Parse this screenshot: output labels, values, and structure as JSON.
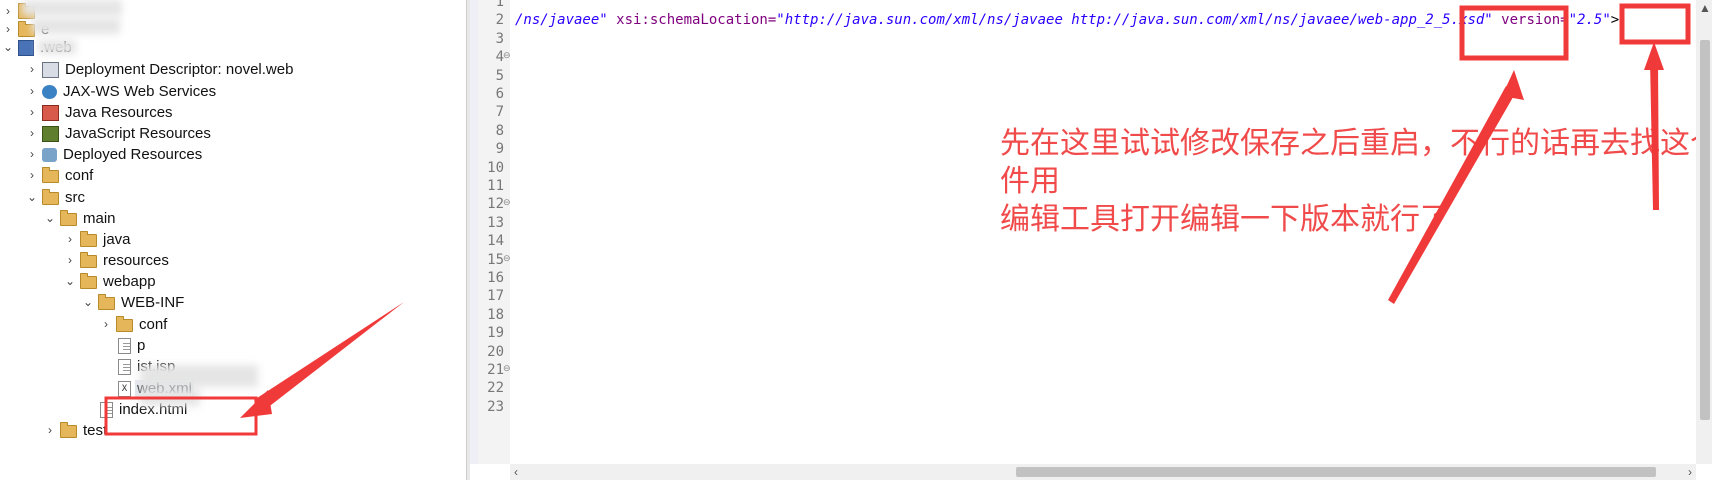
{
  "explorer": {
    "items": [
      {
        "label": "",
        "toggle": "›",
        "icon": "folder-icon"
      },
      {
        "label": "e",
        "toggle": "›",
        "icon": "folder-icon"
      },
      {
        "label": ".web",
        "toggle": "⌄",
        "icon": "web-project-icon"
      },
      {
        "label": "Deployment Descriptor: novel.web",
        "toggle": "›",
        "icon": "deployment-descriptor-icon"
      },
      {
        "label": "JAX-WS Web Services",
        "toggle": "›",
        "icon": "web-services-icon"
      },
      {
        "label": "Java Resources",
        "toggle": "›",
        "icon": "java-resources-icon"
      },
      {
        "label": "JavaScript Resources",
        "toggle": "›",
        "icon": "javascript-resources-icon"
      },
      {
        "label": "Deployed Resources",
        "toggle": "›",
        "icon": "deployed-resources-icon"
      },
      {
        "label": "conf",
        "toggle": "›",
        "icon": "folder-icon"
      },
      {
        "label": "src",
        "toggle": "⌄",
        "icon": "folder-icon"
      },
      {
        "label": "main",
        "toggle": "⌄",
        "icon": "folder-icon"
      },
      {
        "label": "java",
        "toggle": "›",
        "icon": "folder-icon"
      },
      {
        "label": "resources",
        "toggle": "›",
        "icon": "folder-icon"
      },
      {
        "label": "webapp",
        "toggle": "⌄",
        "icon": "folder-icon"
      },
      {
        "label": "WEB-INF",
        "toggle": "⌄",
        "icon": "folder-icon"
      },
      {
        "label": "conf",
        "toggle": "›",
        "icon": "folder-icon"
      },
      {
        "label": "p",
        "toggle": "",
        "icon": "file-icon"
      },
      {
        "label": "ist.jsp",
        "toggle": "",
        "icon": "file-icon"
      },
      {
        "label": "web.xml",
        "toggle": "",
        "icon": "xml-file-icon",
        "selected": true
      },
      {
        "label": "index.html",
        "toggle": "",
        "icon": "file-icon"
      },
      {
        "label": "test",
        "toggle": "›",
        "icon": "folder-icon"
      }
    ]
  },
  "editor": {
    "line_numbers": [
      "1",
      "2",
      "3",
      "4",
      "5",
      "6",
      "7",
      "8",
      "9",
      "10",
      "11",
      "12",
      "13",
      "14",
      "15",
      "16",
      "17",
      "18",
      "19",
      "20",
      "21",
      "22",
      "23"
    ],
    "code_line2": {
      "part1": "/ns/javaee\"",
      "part2": " xsi:schemaLocation=",
      "part3": "\"http://java.sun.com/xml/ns/javaee http://java.sun.com/xml/ns/javaee/web-app_2_5.xsd\"",
      "part4": " version=",
      "part5": "\"2.5\"",
      "part6": ">"
    },
    "annotation_line1": "先在这里试试修改保存之后重启，不行的话再去找这个原文件用",
    "annotation_line2": "编辑工具打开编辑一下版本就行了"
  },
  "colors": {
    "highlight": "#f03a3a",
    "annotation": "#f04a4a",
    "string": "#2a00ff",
    "attribute": "#7f007f"
  }
}
